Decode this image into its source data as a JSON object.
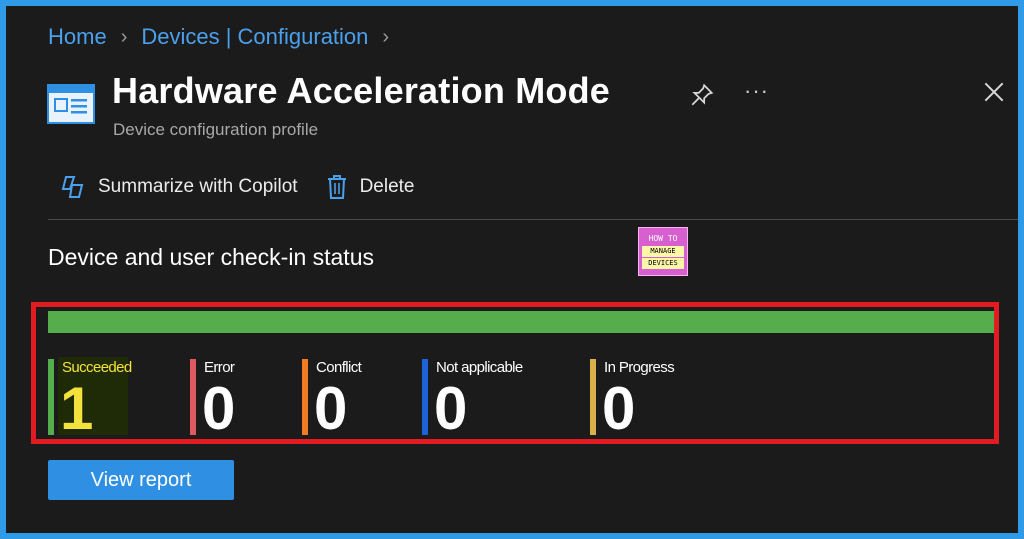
{
  "breadcrumb": [
    "Home",
    "Devices | Configuration"
  ],
  "header": {
    "title": "Hardware Acceleration Mode",
    "subtitle": "Device configuration profile",
    "more_label": "···"
  },
  "toolbar": {
    "copilot_label": "Summarize with Copilot",
    "delete_label": "Delete"
  },
  "section": {
    "title": "Device and user check-in status"
  },
  "logo": {
    "line1": "HOW TO",
    "line2": "MANAGE",
    "line3": "DEVICES"
  },
  "status_bar": {
    "succeeded_fraction": 1.0,
    "color": "#55ad4c"
  },
  "stats": [
    {
      "label": "Succeeded",
      "value": "1",
      "color": "#55ad4c"
    },
    {
      "label": "Error",
      "value": "0",
      "color": "#e0595f"
    },
    {
      "label": "Conflict",
      "value": "0",
      "color": "#f07c23"
    },
    {
      "label": "Not applicable",
      "value": "0",
      "color": "#1c62d8"
    },
    {
      "label": "In Progress",
      "value": "0",
      "color": "#d9b04a"
    }
  ],
  "actions": {
    "view_report_label": "View report"
  },
  "colors": {
    "accent": "#2f8fe3",
    "highlight_border": "#e21b22",
    "frame": "#2f9be8"
  }
}
